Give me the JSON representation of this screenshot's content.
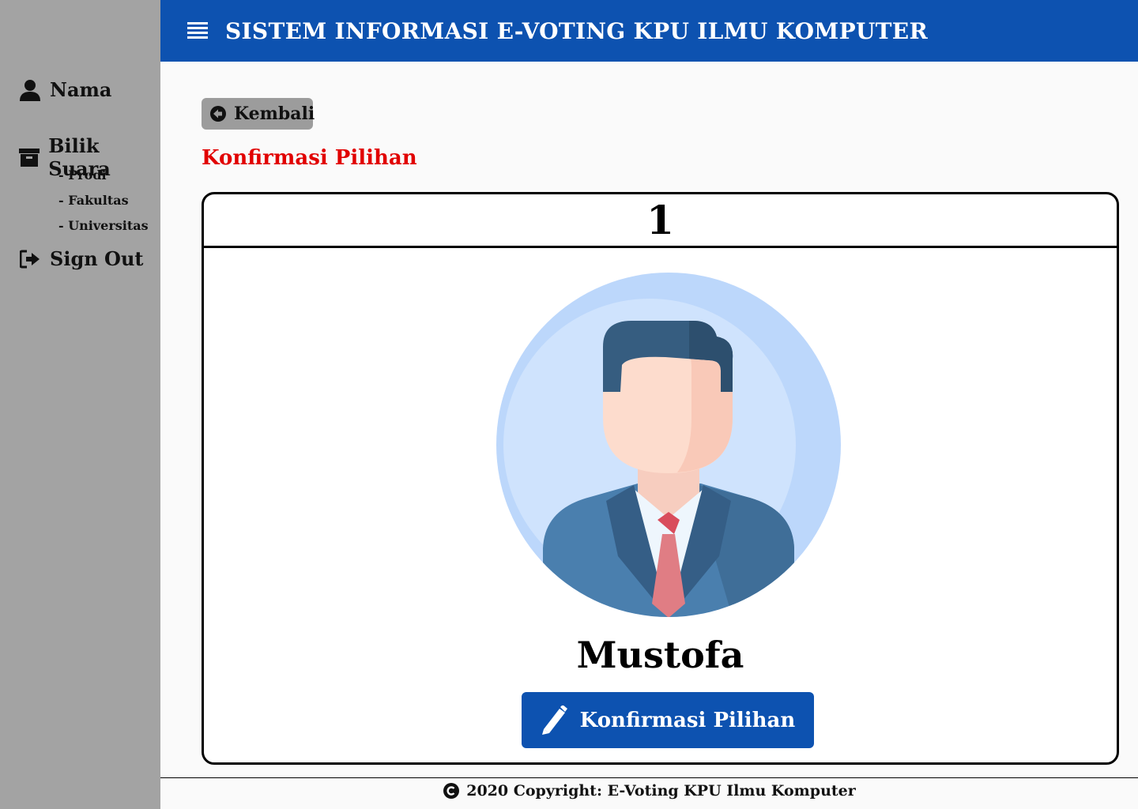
{
  "sidebar": {
    "items": [
      {
        "label": "Nama",
        "icon": "user-icon"
      },
      {
        "label": "Bilik Suara",
        "icon": "archive-icon"
      },
      {
        "label": "Sign Out",
        "icon": "sign-out-icon"
      }
    ],
    "subitems": [
      "- Prodi",
      "- Fakultas",
      "- Universitas"
    ]
  },
  "header": {
    "title": "SISTEM INFORMASI E-VOTING KPU ILMU KOMPUTER",
    "menu_icon": "hamburger-icon"
  },
  "main": {
    "back_label": "Kembali",
    "back_icon": "arrow-circle-left-icon",
    "section_title": "Konfirmasi Pilihan",
    "candidate": {
      "number": "1",
      "name": "Mustofa",
      "photo_icon": "candidate-avatar"
    },
    "confirm_label": "Konfirmasi Pilihan",
    "confirm_icon": "pencil-icon"
  },
  "footer": {
    "text": "2020 Copyright: E-Voting KPU Ilmu Komputer",
    "icon": "copyright-icon"
  },
  "colors": {
    "primary": "#0d52b0",
    "sidebar": "#a3a3a3",
    "accent_red": "#e10000"
  }
}
